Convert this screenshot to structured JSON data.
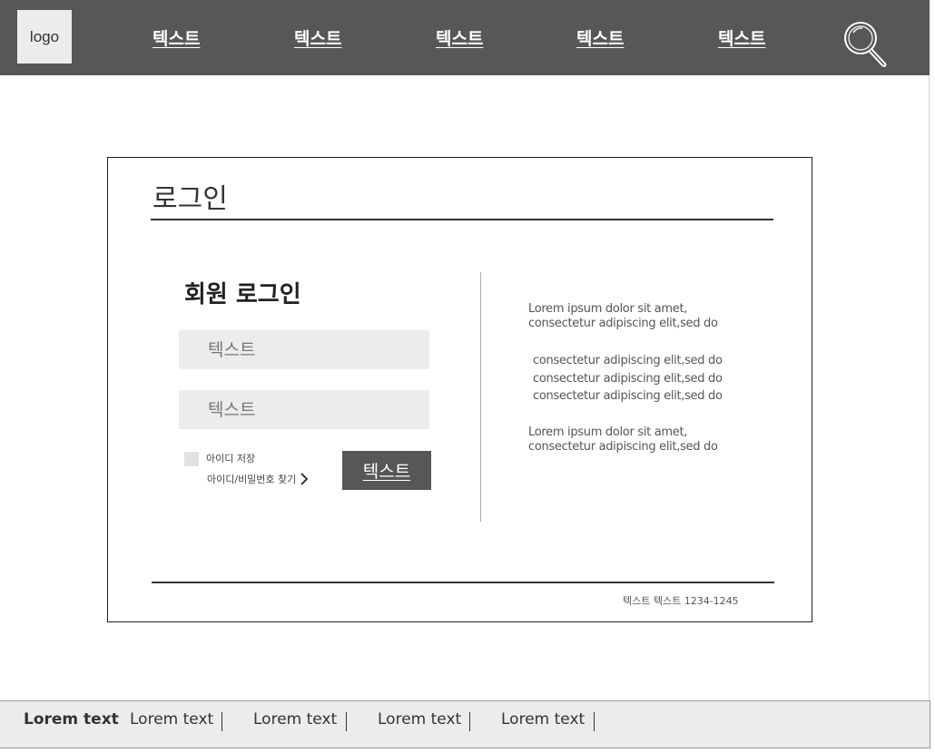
{
  "header": {
    "logo": "logo",
    "nav": [
      "텍스트",
      "텍스트",
      "텍스트",
      "텍스트",
      "텍스트"
    ],
    "search_icon": "search-icon",
    "background": "#575757"
  },
  "login": {
    "page_title": "로그인",
    "section_title": "회원 로그인",
    "id_placeholder": "텍스트",
    "pw_placeholder": "텍스트",
    "remember_label": "아이디 저장",
    "find_link": "아이디/비밀번호 찾기",
    "submit_label": "텍스트",
    "info_paragraphs": [
      [
        "Lorem ipsum dolor sit amet,",
        "consectetur adipiscing elit,sed do"
      ],
      [
        "consectetur adipiscing elit,sed do",
        "consectetur adipiscing elit,sed do",
        "consectetur adipiscing elit,sed do"
      ],
      [
        "Lorem ipsum dolor sit amet,",
        "consectetur adipiscing elit,sed do"
      ]
    ],
    "contact": "텍스트 텍스트 1234-1245"
  },
  "footer": {
    "links": [
      "Lorem text",
      "Lorem text",
      "Lorem text",
      "Lorem text",
      "Lorem text"
    ],
    "background": "#ececec"
  }
}
